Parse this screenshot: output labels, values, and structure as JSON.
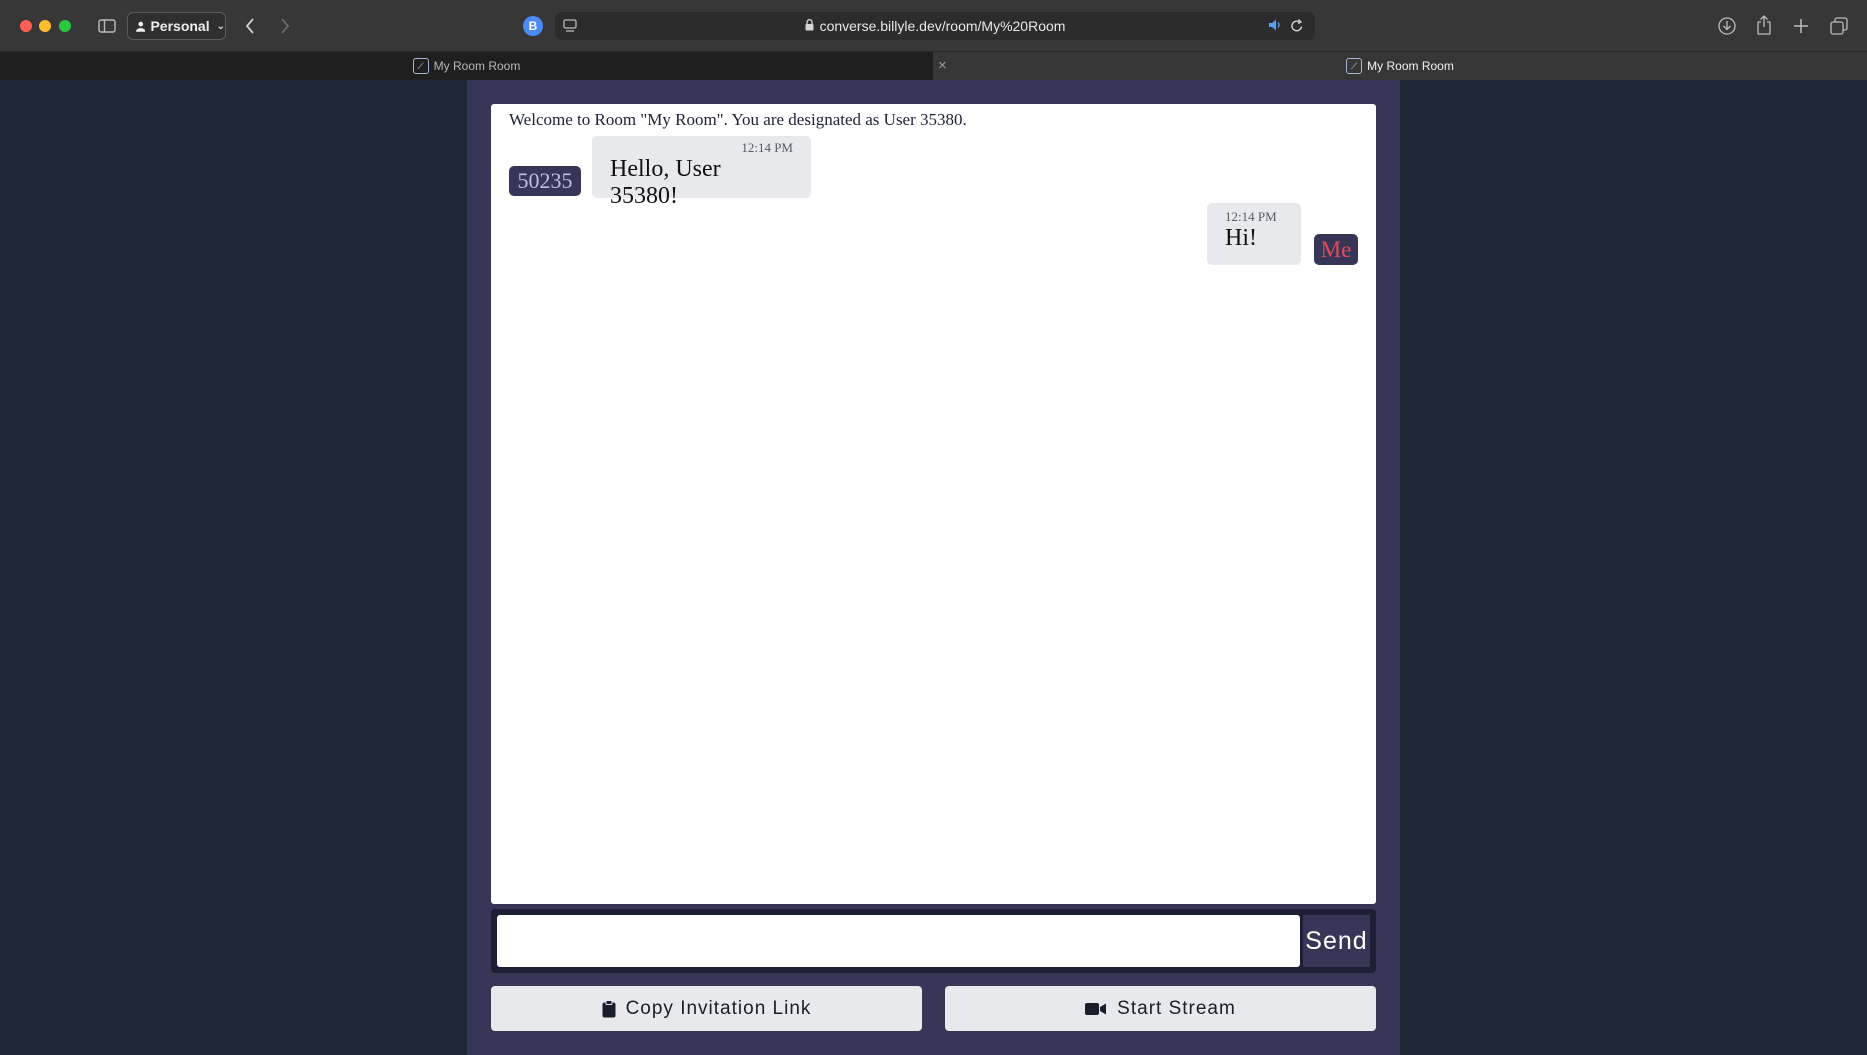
{
  "browser": {
    "profile_label": "Personal",
    "extension_badge": "B",
    "url": "converse.billyle.dev/room/My%20Room",
    "tabs": [
      {
        "title": "My Room Room",
        "active": false
      },
      {
        "title": "My Room Room",
        "active": true
      }
    ],
    "tab_close_glyph": "×"
  },
  "room": {
    "welcome_text": "Welcome to Room \"My Room\". You are designated as User 35380."
  },
  "messages": [
    {
      "sender_label": "50235",
      "time": "12:14 PM",
      "text": "Hello, User 35380!",
      "from_me": false
    },
    {
      "sender_label": "Me",
      "time": "12:14 PM",
      "text": "Hi!",
      "from_me": true
    }
  ],
  "composer": {
    "input_value": "",
    "placeholder": "",
    "send_label": "Send"
  },
  "actions": {
    "copy_invitation_label": "Copy Invitation Link",
    "start_stream_label": "Start Stream"
  },
  "colors": {
    "page_background": "#1e2735",
    "column_background": "#383656",
    "bubble_background": "#e8e9ec",
    "me_label_color": "#e24a55"
  },
  "icons": {
    "copy_invitation": "clipboard-icon",
    "start_stream": "video-camera-icon"
  }
}
